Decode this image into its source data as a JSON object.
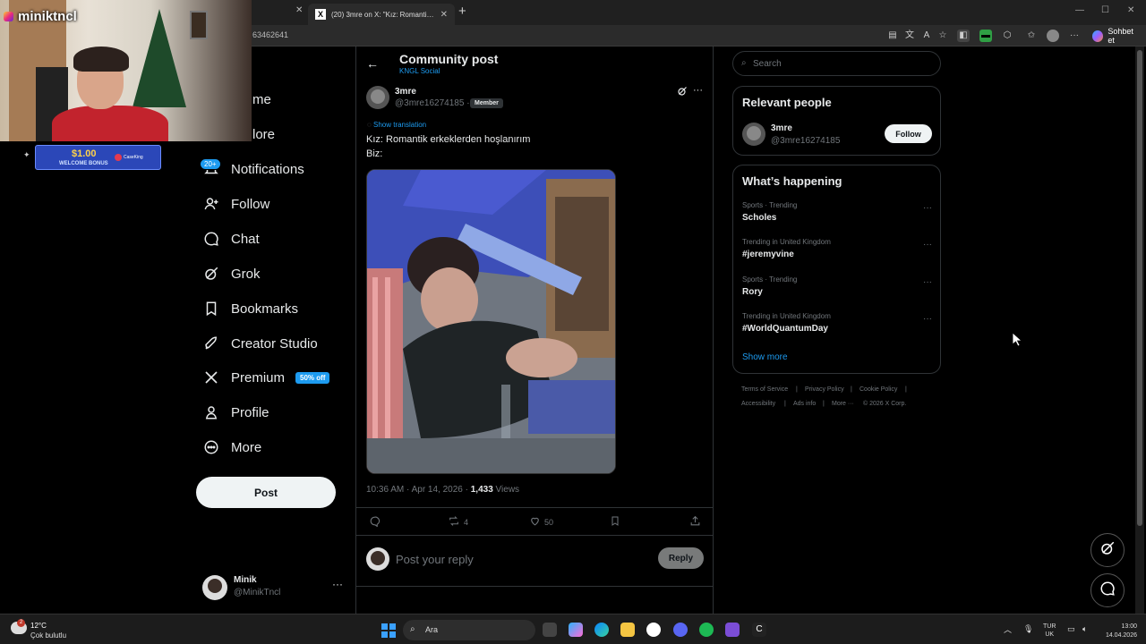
{
  "browser": {
    "active_tab_title": "(20) 3mre on X: \"Kız: Romantik erk",
    "url": "63462641",
    "copilot_label": "Sohbet et"
  },
  "overlay": {
    "streamer_name": "miniktncl",
    "promo_amount": "$1.00",
    "promo_text": "WELCOME BONUS",
    "promo_brand": "CaseKing"
  },
  "nav": {
    "partial_home": "me",
    "partial_explore": "lore",
    "notifications_badge": "20+",
    "items": [
      {
        "label": "Notifications"
      },
      {
        "label": "Follow"
      },
      {
        "label": "Chat"
      },
      {
        "label": "Grok"
      },
      {
        "label": "Bookmarks"
      },
      {
        "label": "Creator Studio"
      },
      {
        "label": "Premium"
      },
      {
        "label": "Profile"
      },
      {
        "label": "More"
      }
    ],
    "premium_badge": "50% off",
    "post_button": "Post",
    "account": {
      "name": "Minik",
      "handle": "@MinikTncl"
    }
  },
  "header": {
    "title": "Community post",
    "subtitle": "KNGL Social"
  },
  "post": {
    "author_name": "3mre",
    "author_handle": "@3mre16274185 ·",
    "member_badge": "Member",
    "show_translation": "Show translation",
    "text_line1": "Kız: Romantik erkeklerden hoşlanırım",
    "text_line2": "Biz:",
    "meta_time": "10:36 AM · Apr 14, 2026 · ",
    "meta_views_count": "1,433",
    "meta_views_label": " Views",
    "reposts": "4",
    "likes": "50",
    "reply_placeholder": "Post your reply",
    "reply_button": "Reply"
  },
  "sidebar": {
    "search_placeholder": "Search",
    "relevant_title": "Relevant people",
    "relevant_name": "3mre",
    "relevant_handle": "@3mre16274185",
    "follow_label": "Follow",
    "happening_title": "What’s happening",
    "trends": [
      {
        "category": "Sports · Trending",
        "name": "Scholes"
      },
      {
        "category": "Trending in United Kingdom",
        "name": "#jeremyvine"
      },
      {
        "category": "Sports · Trending",
        "name": "Rory"
      },
      {
        "category": "Trending in United Kingdom",
        "name": "#WorldQuantumDay"
      }
    ],
    "show_more": "Show more",
    "footer": [
      "Terms of Service",
      "|",
      "Privacy Policy",
      "|",
      "Cookie Policy",
      "|",
      "Accessibility",
      "|",
      "Ads info",
      "|",
      "More ···",
      "© 2026 X Corp."
    ]
  },
  "taskbar": {
    "temp": "12°C",
    "weather": "Çok bulutlu",
    "weather_badge": "2",
    "search_label": "Ara",
    "lang1": "TUR",
    "lang2": "UK",
    "time": "13:00",
    "date": "14.04.2026"
  }
}
